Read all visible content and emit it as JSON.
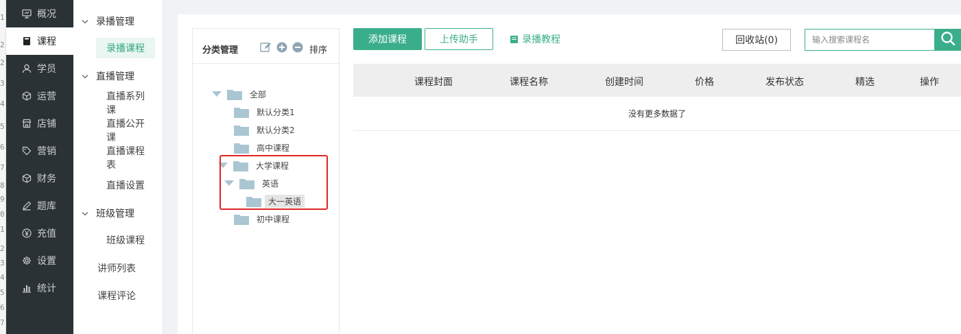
{
  "edge_digits": [
    "1",
    "2",
    "2",
    "3",
    "4",
    "5",
    "6",
    "7",
    "8",
    "9",
    "0",
    "1",
    "2",
    "3",
    "4",
    "5",
    "6",
    "7"
  ],
  "nav": [
    {
      "label": "概况",
      "icon": "monitor-icon",
      "active": false
    },
    {
      "label": "课程",
      "icon": "book-icon",
      "active": true
    },
    {
      "label": "学员",
      "icon": "user-icon",
      "active": false
    },
    {
      "label": "运营",
      "icon": "cube-icon",
      "active": false
    },
    {
      "label": "店铺",
      "icon": "store-icon",
      "active": false
    },
    {
      "label": "营销",
      "icon": "tag-icon",
      "active": false
    },
    {
      "label": "财务",
      "icon": "cube-icon",
      "active": false
    },
    {
      "label": "题库",
      "icon": "pencil-icon",
      "active": false
    },
    {
      "label": "充值",
      "icon": "yen-icon",
      "active": false
    },
    {
      "label": "设置",
      "icon": "gear-icon",
      "active": false
    },
    {
      "label": "统计",
      "icon": "bar-chart-icon",
      "active": false
    }
  ],
  "subnav": {
    "recorded_group": "录播管理",
    "recorded_course": "录播课程",
    "live_group": "直播管理",
    "live_series": "直播系列课",
    "live_open": "直播公开课",
    "live_schedule": "直播课程表",
    "live_settings": "直播设置",
    "class_group": "班级管理",
    "class_course": "班级课程",
    "teacher_list": "讲师列表",
    "course_comments": "课程评论"
  },
  "category": {
    "title": "分类管理",
    "sort_label": "排序",
    "tree": {
      "all": "全部",
      "default1": "默认分类1",
      "default2": "默认分类2",
      "high_school": "高中课程",
      "university": "大学课程",
      "english": "英语",
      "freshman_english": "大一英语",
      "junior_high": "初中课程"
    }
  },
  "toolbar": {
    "add_course": "添加课程",
    "upload_helper": "上传助手",
    "recording_tutorial": "录播教程",
    "recycle_bin": "回收站(0)",
    "search_placeholder": "输入搜索课程名"
  },
  "table": {
    "columns": [
      "课程封面",
      "课程名称",
      "创建时间",
      "价格",
      "发布状态",
      "精选",
      "操作"
    ],
    "empty_text": "没有更多数据了"
  },
  "colors": {
    "accent": "#3aae8a",
    "nav_bg": "#2b3235",
    "highlight_box": "#e02424",
    "folder": "#a9c6d2"
  }
}
